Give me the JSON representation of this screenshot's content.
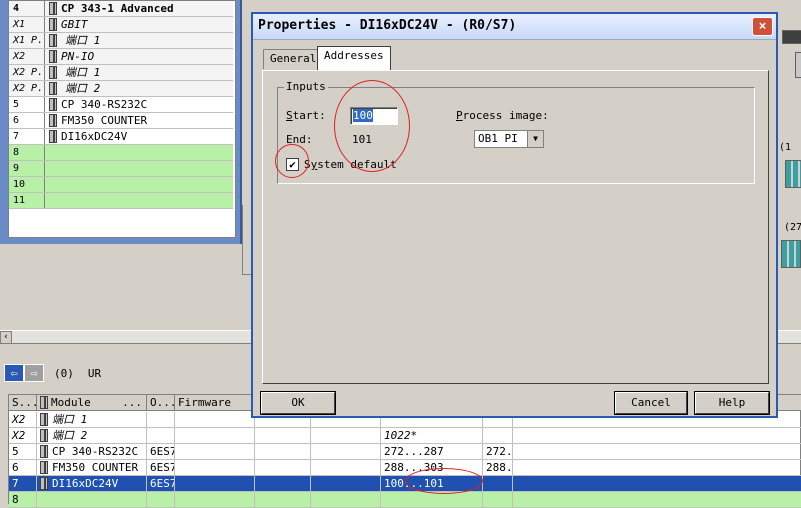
{
  "rack": {
    "rows": [
      {
        "slot": "4",
        "name": "CP 343-1 Advanced",
        "bold": true,
        "icon": true,
        "indent": false
      },
      {
        "slot": "X1",
        "name": "GBIT",
        "italic": true,
        "icon": true,
        "indent": false
      },
      {
        "slot": "X1 P.",
        "name": "端口 1",
        "italic": true,
        "icon": true,
        "indent": true
      },
      {
        "slot": "X2",
        "name": "PN-IO",
        "italic": true,
        "icon": true,
        "indent": false
      },
      {
        "slot": "X2 P.",
        "name": "端口 1",
        "italic": true,
        "icon": true,
        "indent": true
      },
      {
        "slot": "X2 P.",
        "name": "端口 2",
        "italic": true,
        "icon": true,
        "indent": true
      },
      {
        "slot": "5",
        "name": "CP 340-RS232C",
        "icon": true
      },
      {
        "slot": "6",
        "name": "FM350 COUNTER",
        "icon": true
      },
      {
        "slot": "7",
        "name": "DI16xDC24V",
        "icon": true
      },
      {
        "slot": "8",
        "name": "",
        "green": true
      },
      {
        "slot": "9",
        "name": "",
        "green": true
      },
      {
        "slot": "10",
        "name": "",
        "green": true
      },
      {
        "slot": "11",
        "name": "",
        "green": true
      }
    ]
  },
  "right_side": {
    "label_1": "(1",
    "label_2": "(27"
  },
  "bottom": {
    "station_label": "(0)",
    "station_name": "UR",
    "headers": [
      "S...",
      "Module",
      "...",
      "O...",
      "Firmware",
      "",
      "",
      "",
      ""
    ],
    "rows": [
      {
        "slot": "X2",
        "module": "端口 1",
        "order": "",
        "iaddr": "",
        "qaddr": "",
        "italic": true
      },
      {
        "slot": "X2",
        "module": "端口 2",
        "order": "",
        "iaddr": "1022*",
        "qaddr": "",
        "italic": true
      },
      {
        "slot": "5",
        "module": "CP 340-RS232C",
        "order": "6ES7",
        "iaddr": "272...287",
        "qaddr": "272.."
      },
      {
        "slot": "6",
        "module": "FM350 COUNTER",
        "order": "6ES7",
        "iaddr": "288...303",
        "qaddr": "288.."
      },
      {
        "slot": "7",
        "module": "DI16xDC24V",
        "order": "6ES7",
        "iaddr": "100...101",
        "qaddr": "",
        "selected": true
      },
      {
        "slot": "8",
        "module": "",
        "order": "",
        "iaddr": "",
        "qaddr": "",
        "green": true
      }
    ]
  },
  "dialog": {
    "title": "Properties - DI16xDC24V - (R0/S7)",
    "close": "×",
    "tabs": [
      "General",
      "Addresses"
    ],
    "active_tab": "Addresses",
    "group_title": "Inputs",
    "start_label": "Start:",
    "start_value": "100",
    "end_label": "End:",
    "end_value": "101",
    "system_default_label": "System default",
    "system_default_checked": true,
    "process_image_label": "Process image:",
    "process_image_value": "OB1 PI",
    "ok": "OK",
    "cancel": "Cancel",
    "help": "Help"
  }
}
